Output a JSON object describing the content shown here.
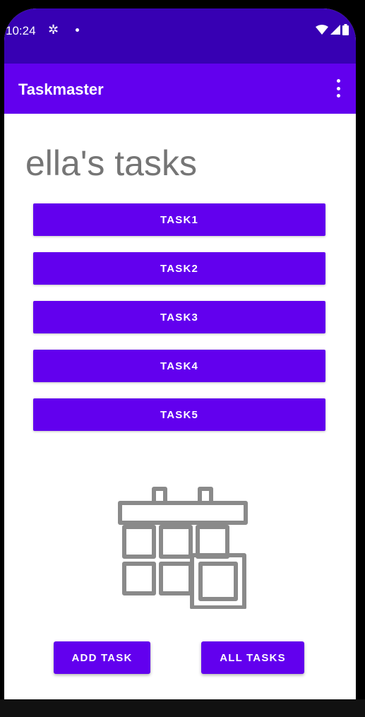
{
  "status_bar": {
    "time": "10:24",
    "settings_icon": "gear-icon",
    "notification_dot": "dot-icon",
    "wifi_icon": "wifi-icon",
    "signal_icon": "signal-icon",
    "battery_icon": "battery-icon"
  },
  "app_bar": {
    "title": "Taskmaster",
    "menu_icon": "overflow-menu-icon"
  },
  "main": {
    "heading": "ella's tasks",
    "tasks": [
      {
        "label": "TASK1"
      },
      {
        "label": "TASK2"
      },
      {
        "label": "TASK3"
      },
      {
        "label": "TASK4"
      },
      {
        "label": "TASK5"
      }
    ],
    "illustration_icon": "calendar-grid-icon"
  },
  "actions": {
    "add_task_label": "ADD TASK",
    "all_tasks_label": "ALL TASKS"
  },
  "colors": {
    "status_bar": "#3700b3",
    "primary": "#6200ee",
    "heading_text": "#757575"
  }
}
